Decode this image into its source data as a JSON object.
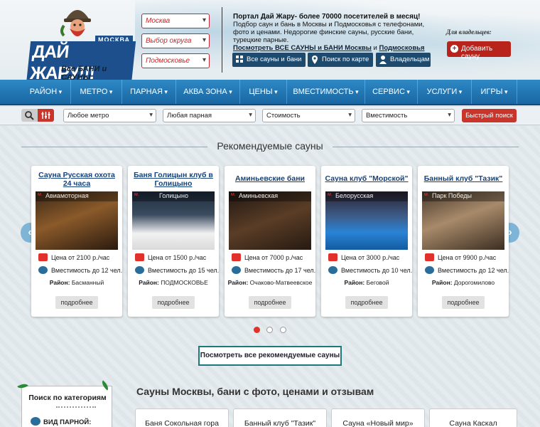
{
  "header": {
    "logo_main": "ДАЙ ЖАРУ!!!",
    "logo_city": "МОСКВА",
    "logo_sub": "Все БАНИ и САУНЫ",
    "selects": [
      "Москва",
      "Выбор округа",
      "Подмосковье"
    ],
    "info_title": "Портал Дай Жару- более 70000 посетителей в месяц!",
    "info_text": "Подбор саун и бань в Москвы и Подмосковья с телефонами, фото и ценами. Недорогие финские сауны, русские бани, турецкие парные.",
    "info_link_pre": "Посмотреть ВСЕ САУНЫ и БАНИ Москвы",
    "info_link_and": " и ",
    "info_link_post": "Подмосковья",
    "buttons": [
      "Все сауны и бани",
      "Поиск по карте",
      "Владельцам"
    ],
    "owners_label": "Для владельцев:",
    "add_button": "Добавить сауну"
  },
  "nav": [
    "РАЙОН",
    "МЕТРО",
    "ПАРНАЯ",
    "АКВА ЗОНА",
    "ЦЕНЫ",
    "ВМЕСТИМОСТЬ",
    "СЕРВИС",
    "УСЛУГИ",
    "ИГРЫ"
  ],
  "filters": {
    "selects": [
      "Любое метро",
      "Любая парная",
      "Стоимость",
      "Вместимость"
    ],
    "quick_search": "Быстрый поиск"
  },
  "recommended": {
    "title": "Рекомендуемые сауны",
    "more_label": "подробнее",
    "district_label": "Район:",
    "all_button": "Посмотреть все рекомендуемые сауны",
    "colors": {
      "price_icon": "#e2312a",
      "capacity_icon": "#2a6d9a",
      "accent": "#c9352a"
    },
    "cards": [
      {
        "title": "Сауна Русская охота 24 часа",
        "metro": "Авиамоторная",
        "price": "Цена от 2100 р./час",
        "capacity": "Вместимость до 12 чел.",
        "district": "Басманный"
      },
      {
        "title": "Баня Голицын клуб в Голицыно",
        "metro": "Голицыно",
        "price": "Цена от 1500 р./час",
        "capacity": "Вместимость до 15 чел.",
        "district": "ПОДМОСКОВЬЕ"
      },
      {
        "title": "Аминьевские бани",
        "metro": "Аминьевская",
        "price": "Цена от 7000 р./час",
        "capacity": "Вместимость до 17 чел.",
        "district": "Очаково-Матвеевское"
      },
      {
        "title": "Сауна клуб \"Морской\"",
        "metro": "Белорусская",
        "price": "Цена от 3000 р./час",
        "capacity": "Вместимость до 10 чел.",
        "district": "Беговой"
      },
      {
        "title": "Банный клуб \"Тазик\"",
        "metro": "Парк Победы",
        "price": "Цена от 9900 р./час",
        "capacity": "Вместимость до 12 чел.",
        "district": "Дорогомилово"
      }
    ]
  },
  "categories": {
    "title": "Поиск по категориям",
    "first": "ВИД ПАРНОЙ:"
  },
  "bottom": {
    "title": "Сауны Москвы, бани с фото, ценами и отзывам",
    "cards": [
      "Баня Сокольная гора",
      "Банный клуб \"Тазик\"",
      "Сауна «Новый мир»",
      "Сауна Каскал"
    ]
  }
}
